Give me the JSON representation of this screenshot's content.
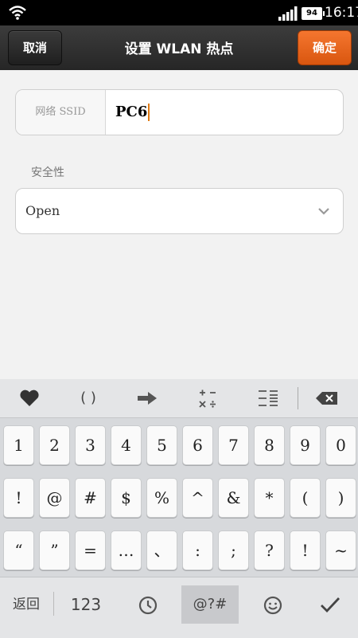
{
  "status_bar": {
    "battery": "94",
    "time": "16:17"
  },
  "title_bar": {
    "cancel_label": "取消",
    "title": "设置 WLAN 热点",
    "confirm_label": "确定"
  },
  "form": {
    "ssid_label": "网络 SSID",
    "ssid_value": "PC6",
    "security_label": "安全性",
    "security_value": "Open"
  },
  "keyboard": {
    "toolbar": [
      "heart-icon",
      "()",
      "arrow-right-icon",
      "+−×÷",
      "text-layout-icon",
      "backspace-icon"
    ],
    "toolbar_parens": "( )",
    "row1": [
      "1",
      "2",
      "3",
      "4",
      "5",
      "6",
      "7",
      "8",
      "9",
      "0"
    ],
    "row2": [
      "!",
      "@",
      "#",
      "$",
      "%",
      "^",
      "&",
      "*",
      "(",
      ")"
    ],
    "row3": [
      "“",
      "”",
      "=",
      "…",
      "、",
      ":",
      ";",
      "?",
      "!",
      "~"
    ],
    "bottom": {
      "back_label": "返回",
      "numeric_label": "123",
      "symbols_label": "@?#"
    }
  }
}
